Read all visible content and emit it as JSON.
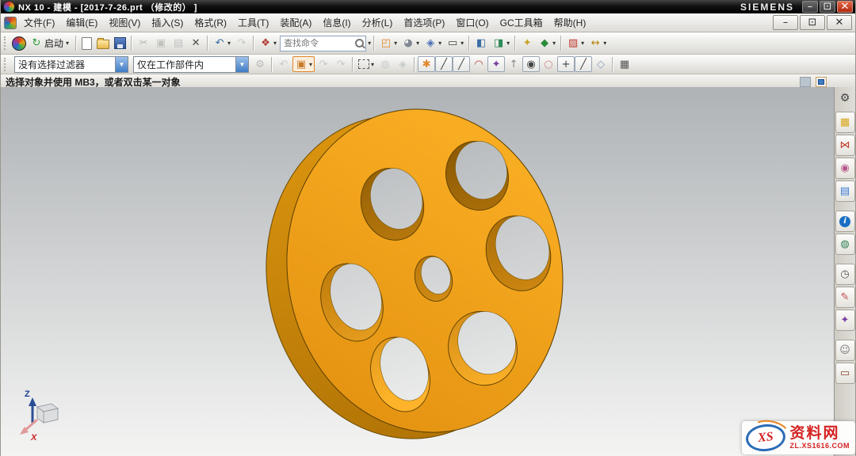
{
  "window": {
    "title": "NX 10 - 建模 - [2017-7-26.prt （修改的） ]",
    "brand": "SIEMENS",
    "controls": [
      {
        "name": "minimize-button",
        "glyph": "–",
        "color": "#eeeeee"
      },
      {
        "name": "restore-button",
        "glyph": "⊡",
        "color": "#eeeeee"
      },
      {
        "name": "close-button",
        "glyph": "✕",
        "color": "#ffffff"
      }
    ]
  },
  "mdi": {
    "controls": [
      {
        "name": "mdi-minimize-button",
        "glyph": "–",
        "color": "#333333"
      },
      {
        "name": "mdi-restore-button",
        "glyph": "⊡",
        "color": "#333333"
      },
      {
        "name": "mdi-close-button",
        "glyph": "✕",
        "color": "#333333"
      }
    ]
  },
  "menus": [
    {
      "name": "file-menu",
      "label": "文件(F)"
    },
    {
      "name": "edit-menu",
      "label": "编辑(E)"
    },
    {
      "name": "view-menu",
      "label": "视图(V)"
    },
    {
      "name": "insert-menu",
      "label": "插入(S)"
    },
    {
      "name": "format-menu",
      "label": "格式(R)"
    },
    {
      "name": "tools-menu",
      "label": "工具(T)"
    },
    {
      "name": "assemblies-menu",
      "label": "装配(A)"
    },
    {
      "name": "information-menu",
      "label": "信息(I)"
    },
    {
      "name": "analysis-menu",
      "label": "分析(L)"
    },
    {
      "name": "preferences-menu",
      "label": "首选项(P)"
    },
    {
      "name": "window-menu",
      "label": "窗口(O)"
    },
    {
      "name": "gc-toolbox-menu",
      "label": "GC工具箱"
    },
    {
      "name": "help-menu",
      "label": "帮助(H)"
    }
  ],
  "toolbar1": {
    "start_label": "启动",
    "search_placeholder": "查找命令",
    "items1": [
      {
        "sep": true
      },
      {
        "name": "new-file-button",
        "kind": "page"
      },
      {
        "name": "open-file-button",
        "kind": "folder"
      },
      {
        "name": "save-button",
        "kind": "floppy"
      },
      {
        "sep": true
      },
      {
        "name": "cut-button",
        "glyph": "✂",
        "color": "#666666",
        "disabled": true
      },
      {
        "name": "copy-button",
        "glyph": "▣",
        "color": "#8a8a8a",
        "disabled": true
      },
      {
        "name": "paste-button",
        "glyph": "▤",
        "color": "#8a8a8a",
        "disabled": true
      },
      {
        "name": "delete-button",
        "glyph": "✕",
        "color": "#4a4a4a"
      },
      {
        "sep": true
      },
      {
        "name": "undo-button",
        "glyph": "↶",
        "color": "#3a6ea5",
        "dd": true
      },
      {
        "name": "redo-button",
        "glyph": "↷",
        "color": "#8a97a3",
        "disabled": true
      },
      {
        "sep": true
      },
      {
        "name": "repeat-command-button",
        "glyph": "❖",
        "color": "#b03a2e",
        "dd": true
      }
    ],
    "items2": [
      {
        "name": "fit-view-button",
        "glyph": "◰",
        "color": "#e0862a",
        "dd": true
      },
      {
        "name": "shaded-with-edges-button",
        "glyph": "◕",
        "color": "#7f8892",
        "dd": true
      },
      {
        "name": "isometric-view-button",
        "glyph": "◈",
        "color": "#4a6fb5",
        "dd": true
      },
      {
        "name": "window-select-button",
        "glyph": "▭",
        "color": "#444444",
        "dd": true
      },
      {
        "sep": true
      },
      {
        "name": "show-button",
        "glyph": "◧",
        "color": "#3a6ea5"
      },
      {
        "name": "show-hide-button",
        "glyph": "◨",
        "color": "#2e8b57",
        "dd": true
      },
      {
        "sep": true
      },
      {
        "name": "move-object-button",
        "glyph": "✦",
        "color": "#c9a227"
      },
      {
        "name": "assembly-constraints-button",
        "glyph": "◆",
        "color": "#2e8b3a",
        "dd": true
      },
      {
        "sep": true
      },
      {
        "name": "section-view-button",
        "glyph": "▨",
        "color": "#c0392b",
        "dd": true
      },
      {
        "name": "measure-distance-button",
        "glyph": "↔",
        "color": "#b8860b",
        "dd": true
      }
    ]
  },
  "toolbar2": {
    "filter_value": "没有选择过滤器",
    "scope_value": "仅在工作部件内",
    "items": [
      {
        "name": "snap-preferences-icon",
        "glyph": "⚙",
        "color": "#777777",
        "disabled": true
      },
      {
        "sep": true
      },
      {
        "name": "view-orient-icon",
        "glyph": "↶",
        "color": "#999999",
        "disabled": true
      },
      {
        "name": "point-dialog-button",
        "glyph": "▣",
        "color": "#c87a2a",
        "boxed": true,
        "hl": true,
        "dd": true
      },
      {
        "name": "view-rotate-icon",
        "glyph": "↷",
        "color": "#999999",
        "disabled": true
      },
      {
        "name": "view-pan-icon",
        "glyph": "↷",
        "color": "#999999",
        "disabled": true
      },
      {
        "sep": true
      },
      {
        "name": "select-rect-button",
        "kind": "dashedrect",
        "dd": true
      },
      {
        "name": "shaded-preview-icon",
        "glyph": "◍",
        "color": "#99a5aa",
        "disabled": true
      },
      {
        "name": "solid-preview-icon",
        "glyph": "◈",
        "color": "#8fa3bd",
        "disabled": true
      },
      {
        "sep": true
      },
      {
        "name": "snap-enable-button",
        "glyph": "✱",
        "color": "#e0862a",
        "boxed": true
      },
      {
        "name": "snap-endpoint-button",
        "glyph": "╱",
        "color": "#444444",
        "boxed": true
      },
      {
        "name": "snap-midpoint-button",
        "glyph": "╱",
        "color": "#444444",
        "boxed": true
      },
      {
        "name": "snap-tangent-icon",
        "glyph": "◠",
        "color": "#b03a2e"
      },
      {
        "name": "snap-point-on-curve-button",
        "glyph": "✦",
        "color": "#7a3fa0",
        "boxed": true
      },
      {
        "name": "snap-pole-icon",
        "glyph": "↑",
        "color": "#888888"
      },
      {
        "name": "snap-center-button",
        "glyph": "◉",
        "color": "#444444",
        "boxed": true
      },
      {
        "name": "snap-quadrant-icon",
        "glyph": "○",
        "color": "#d08a8a"
      },
      {
        "name": "snap-intersection-button",
        "glyph": "+",
        "color": "#444444",
        "boxed": true
      },
      {
        "name": "snap-existing-point-button",
        "glyph": "╱",
        "color": "#444444",
        "boxed": true
      },
      {
        "name": "snap-face-icon",
        "glyph": "◇",
        "color": "#8fa3bd"
      },
      {
        "sep": true
      },
      {
        "name": "grid-snap-icon",
        "glyph": "▦",
        "color": "#555555"
      }
    ]
  },
  "prompt": {
    "text": "选择对象并使用 MB3，或者双击某一对象"
  },
  "sidebar": {
    "tabs": [
      {
        "name": "assembly-navigator-tab",
        "glyph": "▦",
        "color": "#d6a516"
      },
      {
        "name": "constraint-navigator-tab",
        "glyph": "⋈",
        "color": "#c0392b"
      },
      {
        "name": "part-navigator-tab",
        "glyph": "◉",
        "color": "#b8588a"
      },
      {
        "name": "reuse-library-tab",
        "glyph": "▤",
        "color": "#3a7bd5"
      },
      {
        "gap": true
      },
      {
        "name": "hd3d-tools-tab",
        "kind": "infocircle",
        "glyph": "i"
      },
      {
        "name": "web-browser-tab",
        "glyph": "◍",
        "color": "#2e7d4f"
      },
      {
        "gap": true
      },
      {
        "name": "history-tab",
        "glyph": "◷",
        "color": "#555555"
      },
      {
        "name": "roles-tab",
        "glyph": "✎",
        "color": "#c05050"
      },
      {
        "name": "scene-pin-tab",
        "glyph": "✦",
        "color": "#7a3fa0"
      },
      {
        "gap": true
      },
      {
        "name": "user-tools-tab",
        "glyph": "☺",
        "color": "#777777"
      },
      {
        "name": "window-tab",
        "glyph": "▭",
        "color": "#8a4b2a"
      }
    ]
  },
  "viewport": {
    "triad_z": "Z",
    "triad_x": "X"
  },
  "watermark": {
    "logo": "XS",
    "name": "资料网",
    "url": "ZL.XS1616.COM"
  },
  "colors": {
    "model_face": "#F0A11B",
    "model_rim": "#C9830C",
    "background_top": "#AFB3B6",
    "background_bottom": "#F4F4F3",
    "titlebar": "#000000"
  }
}
